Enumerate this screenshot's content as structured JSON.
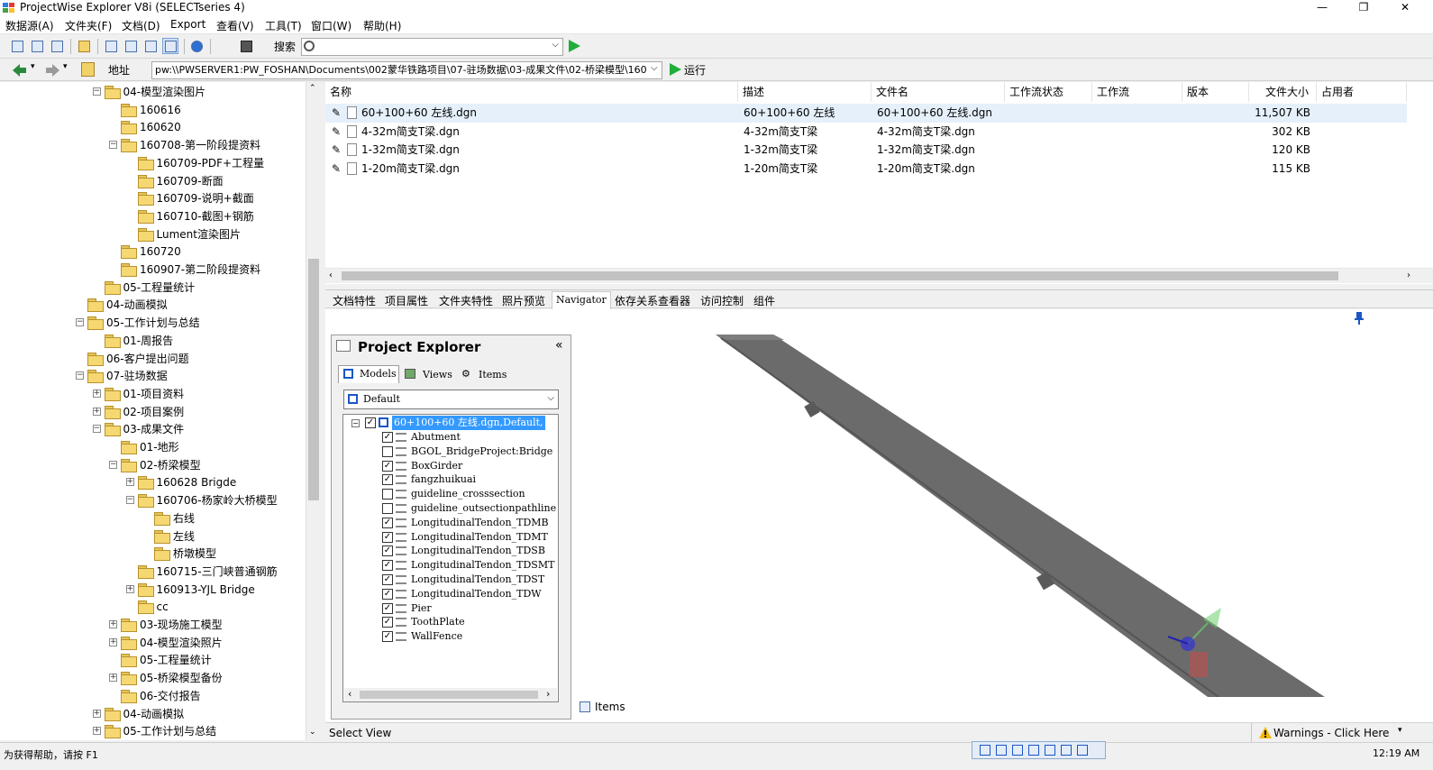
{
  "window": {
    "title": "ProjectWise Explorer V8i (SELECTseries 4)",
    "minimize": "—",
    "maximize": "❐",
    "close": "✕"
  },
  "menu": [
    "数据源(A)",
    "文件夹(F)",
    "文档(D)",
    "Export",
    "查看(V)",
    "工具(T)",
    "窗口(W)",
    "帮助(H)"
  ],
  "toolbar": {
    "search_label": "搜索",
    "search_value": ""
  },
  "address": {
    "label": "地址",
    "path": "pw:\\\\PWSERVER1:PW_FOSHAN\\Documents\\002蒙华铁路项目\\07-驻场数据\\03-成果文件\\02-桥梁模型\\160",
    "go_label": "运行"
  },
  "tree": [
    {
      "level": 5,
      "exp": "−",
      "label": "04-模型渲染图片"
    },
    {
      "level": 6,
      "exp": "",
      "label": "160616"
    },
    {
      "level": 6,
      "exp": "",
      "label": "160620"
    },
    {
      "level": 6,
      "exp": "−",
      "label": "160708-第一阶段提资料"
    },
    {
      "level": 7,
      "exp": "",
      "label": "160709-PDF+工程量"
    },
    {
      "level": 7,
      "exp": "",
      "label": "160709-断面"
    },
    {
      "level": 7,
      "exp": "",
      "label": "160709-说明+截面"
    },
    {
      "level": 7,
      "exp": "",
      "label": "160710-截图+钢筋"
    },
    {
      "level": 7,
      "exp": "",
      "label": "Lument渲染图片"
    },
    {
      "level": 6,
      "exp": "",
      "label": "160720"
    },
    {
      "level": 6,
      "exp": "",
      "label": "160907-第二阶段提资料"
    },
    {
      "level": 5,
      "exp": "",
      "label": "05-工程量统计"
    },
    {
      "level": 4,
      "exp": "",
      "label": "04-动画模拟"
    },
    {
      "level": 4,
      "exp": "−",
      "label": "05-工作计划与总结"
    },
    {
      "level": 5,
      "exp": "",
      "label": "01-周报告"
    },
    {
      "level": 4,
      "exp": "",
      "label": "06-客户提出问题"
    },
    {
      "level": 4,
      "exp": "−",
      "label": "07-驻场数据"
    },
    {
      "level": 5,
      "exp": "+",
      "label": "01-项目资料"
    },
    {
      "level": 5,
      "exp": "+",
      "label": "02-项目案例"
    },
    {
      "level": 5,
      "exp": "−",
      "label": "03-成果文件"
    },
    {
      "level": 6,
      "exp": "",
      "label": "01-地形"
    },
    {
      "level": 6,
      "exp": "−",
      "label": "02-桥梁模型"
    },
    {
      "level": 7,
      "exp": "+",
      "label": "160628 Brigde"
    },
    {
      "level": 7,
      "exp": "−",
      "label": "160706-杨家岭大桥模型"
    },
    {
      "level": 8,
      "exp": "",
      "label": "右线"
    },
    {
      "level": 8,
      "exp": "",
      "label": "左线"
    },
    {
      "level": 8,
      "exp": "",
      "label": "桥墩模型"
    },
    {
      "level": 7,
      "exp": "",
      "label": "160715-三门峡普通钢筋"
    },
    {
      "level": 7,
      "exp": "+",
      "label": "160913-YJL Bridge"
    },
    {
      "level": 7,
      "exp": "",
      "label": "cc"
    },
    {
      "level": 6,
      "exp": "+",
      "label": "03-现场施工模型"
    },
    {
      "level": 6,
      "exp": "+",
      "label": "04-模型渲染照片"
    },
    {
      "level": 6,
      "exp": "",
      "label": "05-工程量统计"
    },
    {
      "level": 6,
      "exp": "+",
      "label": "05-桥梁模型备份"
    },
    {
      "level": 6,
      "exp": "",
      "label": "06-交付报告"
    },
    {
      "level": 5,
      "exp": "+",
      "label": "04-动画模拟"
    },
    {
      "level": 5,
      "exp": "+",
      "label": "05-工作计划与总结"
    }
  ],
  "filelist": {
    "headers": [
      "名称",
      "描述",
      "文件名",
      "工作流状态",
      "工作流",
      "版本",
      "文件大小",
      "占用者"
    ],
    "rows": [
      {
        "name": "60+100+60 左线.dgn",
        "desc": "60+100+60 左线",
        "file": "60+100+60 左线.dgn",
        "size": "11,507 KB"
      },
      {
        "name": "4-32m简支T梁.dgn",
        "desc": "4-32m简支T梁",
        "file": "4-32m简支T梁.dgn",
        "size": "302 KB"
      },
      {
        "name": "1-32m简支T梁.dgn",
        "desc": "1-32m简支T梁",
        "file": "1-32m简支T梁.dgn",
        "size": "120 KB"
      },
      {
        "name": "1-20m简支T梁.dgn",
        "desc": "1-20m简支T梁",
        "file": "1-20m简支T梁.dgn",
        "size": "115 KB"
      }
    ]
  },
  "tabs": [
    "文档特性",
    "项目属性",
    "文件夹特性",
    "照片预览",
    "Navigator",
    "依存关系查看器",
    "访问控制",
    "组件"
  ],
  "active_tab": "Navigator",
  "project_explorer": {
    "title": "Project Explorer",
    "collapse": "«",
    "subtabs": [
      "Models",
      "Views",
      "Items"
    ],
    "dropdown": "Default",
    "root": "60+100+60 左线.dgn,Default,",
    "layers": [
      {
        "name": "Abutment",
        "checked": true
      },
      {
        "name": "BGOL_BridgeProject:Bridge",
        "checked": false
      },
      {
        "name": "BoxGirder",
        "checked": true
      },
      {
        "name": "fangzhuikuai",
        "checked": true
      },
      {
        "name": "guideline_crosssection",
        "checked": false
      },
      {
        "name": "guideline_outsectionpathline",
        "checked": false
      },
      {
        "name": "LongitudinalTendon_TDMB",
        "checked": true
      },
      {
        "name": "LongitudinalTendon_TDMT",
        "checked": true
      },
      {
        "name": "LongitudinalTendon_TDSB",
        "checked": true
      },
      {
        "name": "LongitudinalTendon_TDSMT",
        "checked": true
      },
      {
        "name": "LongitudinalTendon_TDST",
        "checked": true
      },
      {
        "name": "LongitudinalTendon_TDW",
        "checked": true
      },
      {
        "name": "Pier",
        "checked": true
      },
      {
        "name": "ToothPlate",
        "checked": true
      },
      {
        "name": "WallFence",
        "checked": true
      }
    ]
  },
  "items_label": "Items",
  "select_view": "Select View",
  "warnings": "Warnings - Click Here",
  "status": {
    "help": "为获得帮助，请按 F1",
    "time": "12:19 AM"
  },
  "colors": {
    "accent": "#0a64d8",
    "selection": "#3399ff",
    "bridge": "#6b6b6b",
    "go_green": "#1fae3a"
  }
}
